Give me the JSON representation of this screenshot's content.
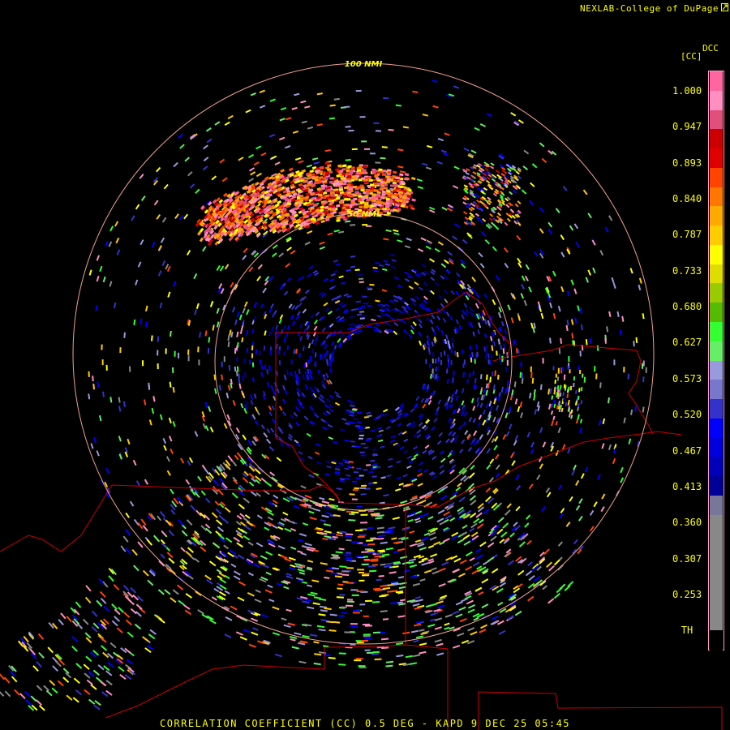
{
  "header": {
    "credit": "NEXLAB-College of DuPage"
  },
  "legend": {
    "product_code": "DCC",
    "unit": "[CC]",
    "ticks": [
      "1.000",
      "0.947",
      "0.893",
      "0.840",
      "0.787",
      "0.733",
      "0.680",
      "0.627",
      "0.573",
      "0.520",
      "0.467",
      "0.413",
      "0.360",
      "0.307",
      "0.253",
      "TH"
    ],
    "colors": [
      "#ff66a0",
      "#ff8fc0",
      "#e0507a",
      "#cc0000",
      "#e00000",
      "#ff4400",
      "#ff7700",
      "#ffaa00",
      "#ffcc00",
      "#ffff00",
      "#dddd00",
      "#99cc00",
      "#55bb00",
      "#33ff33",
      "#66ee66",
      "#9999dd",
      "#7777cc",
      "#3333cc",
      "#0000ff",
      "#0000dd",
      "#0000bb",
      "#000099",
      "#777799",
      "#888888",
      "#888888",
      "#888888",
      "#888888",
      "#888888",
      "#888888",
      "#000000"
    ]
  },
  "range_rings": {
    "outer_label": "100 NMI",
    "inner_label": "50 NMI"
  },
  "footer": {
    "caption": "CORRELATION COEFFICIENT (CC) 0.5 DEG - KAPD 9 DEC 25 05:45"
  }
}
